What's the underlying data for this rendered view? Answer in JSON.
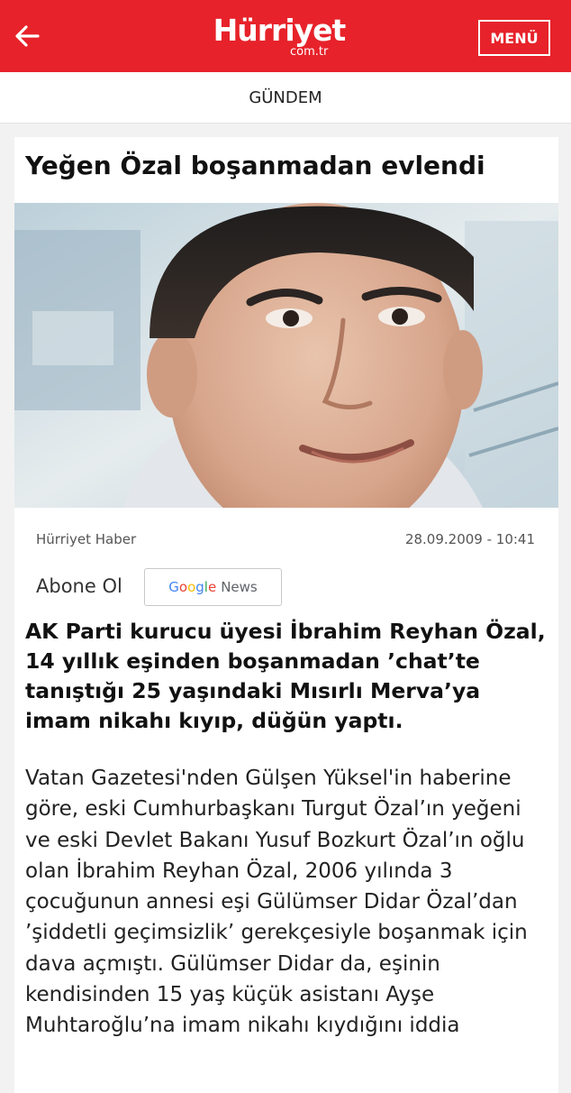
{
  "header": {
    "logo_text": "Hürriyet",
    "logo_sub": "com.tr",
    "menu_label": "MENÜ",
    "brand_color": "#e7222a",
    "back_icon": "arrow-left-icon"
  },
  "section": {
    "label": "GÜNDEM"
  },
  "article": {
    "title": "Yeğen Özal boşanmadan evlendi",
    "source": "Hürriyet Haber",
    "date": "28.09.2009 - 10:41",
    "subscribe_label": "Abone Ol",
    "google_news": {
      "g1": "G",
      "g2": "o",
      "g3": "o",
      "g4": "g",
      "g5": "l",
      "g6": "e",
      "news": "News"
    },
    "lead": "AK Parti kurucu üyesi İbrahim Reyhan Özal, 14 yıllık eşinden boşanmadan ’chat’te tanıştığı 25 yaşındaki Mısırlı Merva’ya imam nikahı kıyıp, düğün yaptı.",
    "body": "Vatan Gazetesi'nden Gülşen Yüksel'in haberine göre, eski Cumhurbaşkanı Turgut Özal’ın yeğeni ve eski Devlet Bakanı Yusuf Bozkurt Özal’ın oğlu olan İbrahim Reyhan Özal, 2006 yılında 3 çocuğunun annesi eşi Gülümser Didar Özal’dan ’şiddetli geçimsizlik’ gerekçesiyle boşanmak için dava açmıştı. Gülümser Didar da, eşinin kendisinden 15 yaş küçük asistanı Ayşe Muhtaroğlu’na imam nikahı kıydığını iddia"
  }
}
